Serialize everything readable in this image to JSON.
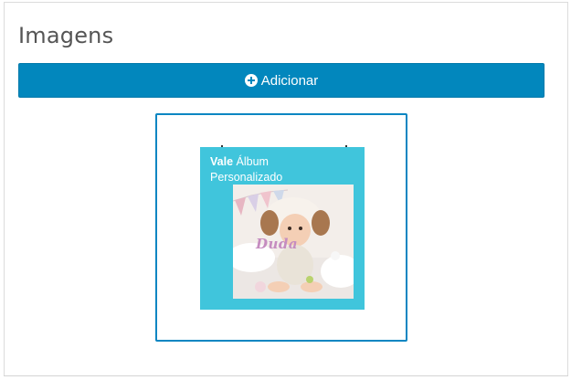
{
  "section": {
    "title": "Imagens"
  },
  "add_button": {
    "label": "Adicionar",
    "icon": "plus-circle-icon",
    "color": "#0287bd"
  },
  "image_card": {
    "brand": "Vale",
    "caption_rest": " Álbum",
    "caption_line2": "Personalizado",
    "photo_text": "Duda",
    "card_color": "#40c5dc",
    "frame_color": "#0b86c2"
  }
}
